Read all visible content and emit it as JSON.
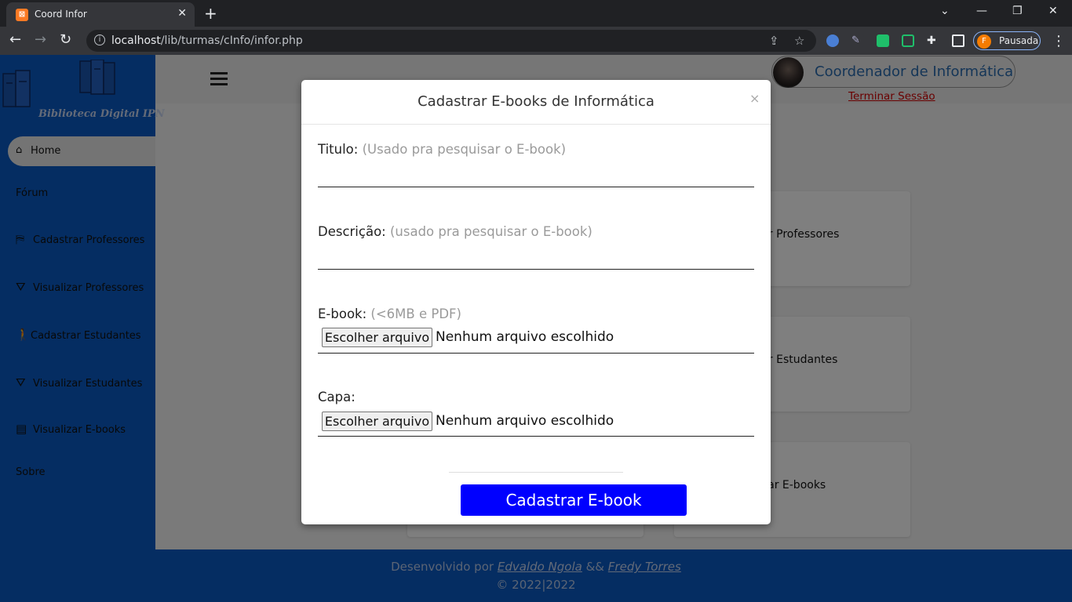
{
  "browser": {
    "tab_title": "Coord Infor",
    "tab_close": "✕",
    "new_tab": "+",
    "url_host": "localhost",
    "url_path": "/lib/turmas/cInfo/infor.php",
    "profile_initial": "F",
    "profile_label": "Pausada"
  },
  "sidebar": {
    "logo_text": "Biblioteca Digital IPN",
    "home": "Home",
    "items": [
      {
        "label": "Fórum",
        "icon": ""
      },
      {
        "label": "Cadastrar Professores",
        "icon": "teacher-icon"
      },
      {
        "label": "Visualizar Professores",
        "icon": "view-teacher-icon"
      },
      {
        "label": "Cadastrar Estudantes",
        "icon": "walking-person-icon"
      },
      {
        "label": "Visualizar Estudantes",
        "icon": "view-student-icon"
      },
      {
        "label": "Visualizar E-books",
        "icon": "book-icon"
      },
      {
        "label": "Sobre",
        "icon": ""
      }
    ]
  },
  "header": {
    "user_name": "Coordenador de Informática",
    "logout": "Terminar Sessão"
  },
  "cards": [
    {
      "label": "zar Professores"
    },
    {
      "label": "zar Estudantes"
    },
    {
      "label": "lizar E-books"
    }
  ],
  "footer": {
    "prefix": "Desenvolvido por",
    "author1": "Edvaldo Ngola",
    "joiner": "&&",
    "author2": "Fredy Torres",
    "copyright": "© 2022|2022"
  },
  "modal": {
    "title": "Cadastrar E-books de Informática",
    "close": "×",
    "fields": {
      "titulo_label": "Titulo:",
      "titulo_hint": "(Usado pra pesquisar o E-book)",
      "descricao_label": "Descrição:",
      "descricao_hint": "(usado pra pesquisar o E-book)",
      "ebook_label": "E-book:",
      "ebook_hint": "(<6MB e PDF)",
      "capa_label": "Capa:",
      "file_button": "Escolher arquivo",
      "file_none": "Nenhum arquivo escolhido"
    },
    "submit": "Cadastrar E-book"
  },
  "colors": {
    "sidebar_bg": "#0a5bc4",
    "submit_bg": "#0000ff",
    "logout": "#d40000"
  }
}
